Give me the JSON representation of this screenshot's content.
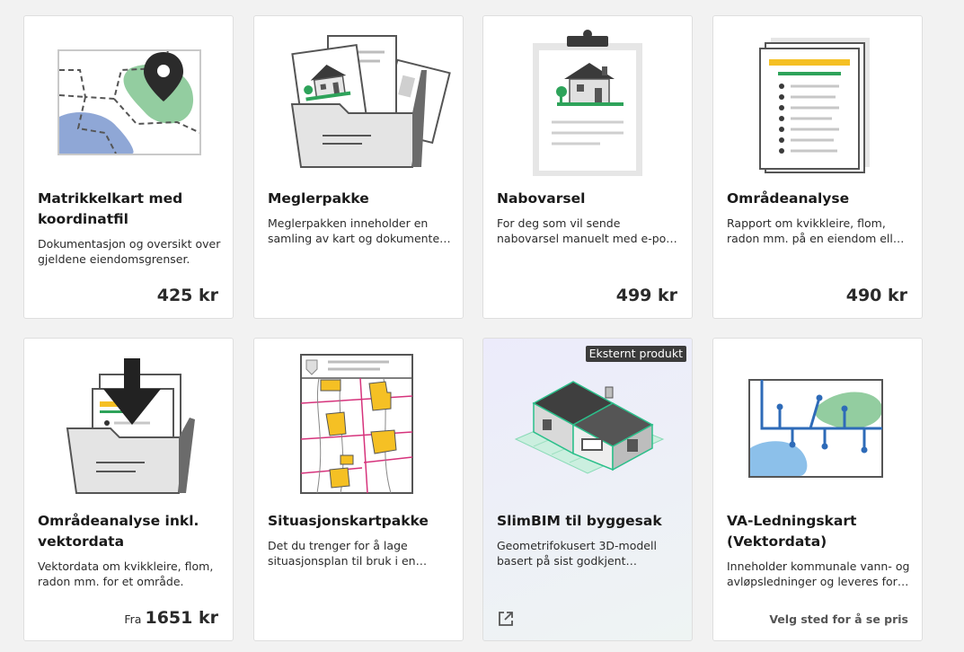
{
  "colors": {
    "page_bg": "#f2f2f2",
    "card_bg": "#ffffff",
    "accent_green": "#2ea35a",
    "accent_yellow": "#f5c024",
    "map_green": "#93cda0",
    "map_blue": "#8fa7d6",
    "pipe_blue": "#2e6bb8",
    "boundary_pink": "#d6337c",
    "badge_bg": "#3b3b3b"
  },
  "products": [
    {
      "icon": "map-pin-icon",
      "title": "Matrikkelkart med koordinatfil",
      "description": "Dokumentasjon og oversikt over gjeldene eiendomsgrenser.",
      "price": "425 kr"
    },
    {
      "icon": "folder-house-icon",
      "title": "Meglerpakke",
      "description": "Meglerpakken inneholder en samling av kart og dokumenter for eiendomsmeglere."
    },
    {
      "icon": "clipboard-house-icon",
      "title": "Nabovarsel",
      "description": "For deg som vil sende nabovarsel manuelt med e-post eller som brev.",
      "price": "499 kr"
    },
    {
      "icon": "document-list-icon",
      "title": "Områdeanalyse",
      "description": "Rapport om kvikkleire, flom, radon mm. på en eiendom eller område.",
      "price": "490 kr"
    },
    {
      "icon": "download-folder-icon",
      "title": "Områdeanalyse inkl. vektordata",
      "description": "Vektordata om kvikkleire, flom, radon mm. for et område.",
      "price_prefix": "Fra",
      "price": "1651 kr"
    },
    {
      "icon": "site-plan-icon",
      "title": "Situasjonskartpakke",
      "description": "Det du trenger for å lage situasjonsplan til bruk i en byggesak."
    },
    {
      "icon": "3d-house-icon",
      "title": "SlimBIM til byggesak",
      "description": "Geometrifokusert 3D-modell basert på sist godkjent situasjonskart.",
      "badge": "Eksternt produkt",
      "link_icon": "external-link-icon"
    },
    {
      "icon": "pipe-map-icon",
      "title": "VA-Ledningskart (Vektordata)",
      "description": "Inneholder kommunale vann- og avløpsledninger og leveres for område.",
      "note": "Velg sted for å se pris"
    }
  ]
}
